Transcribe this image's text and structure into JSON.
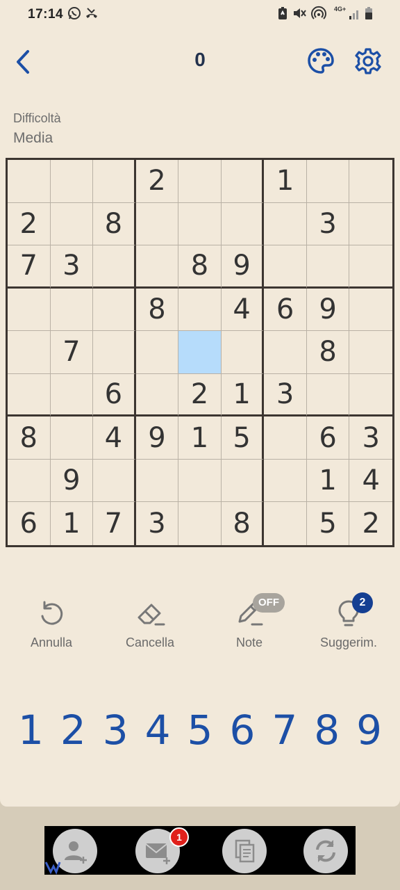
{
  "status_bar": {
    "time": "17:14",
    "network": "4G+",
    "icons": [
      "whatsapp-icon",
      "missed-call-icon",
      "battery-saver-icon",
      "mute-icon",
      "hotspot-icon",
      "signal-icon",
      "battery-icon"
    ]
  },
  "header": {
    "score": "0",
    "back_icon": "chevron-left-icon",
    "theme_icon": "palette-icon",
    "settings_icon": "gear-icon"
  },
  "difficulty": {
    "label": "Difficoltà",
    "value": "Media"
  },
  "grid": [
    [
      "",
      "",
      "",
      "2",
      "",
      "",
      "1",
      "",
      ""
    ],
    [
      "2",
      "",
      "8",
      "",
      "",
      "",
      "",
      "3",
      ""
    ],
    [
      "7",
      "3",
      "",
      "",
      "8",
      "9",
      "",
      "",
      ""
    ],
    [
      "",
      "",
      "",
      "8",
      "",
      "4",
      "6",
      "9",
      ""
    ],
    [
      "",
      "7",
      "",
      "",
      "",
      "",
      "",
      "8",
      ""
    ],
    [
      "",
      "",
      "6",
      "",
      "2",
      "1",
      "3",
      "",
      ""
    ],
    [
      "8",
      "",
      "4",
      "9",
      "1",
      "5",
      "",
      "6",
      "3"
    ],
    [
      "",
      "9",
      "",
      "",
      "",
      "",
      "",
      "1",
      "4"
    ],
    [
      "6",
      "1",
      "7",
      "3",
      "",
      "8",
      "",
      "5",
      "2"
    ]
  ],
  "selected_cell": {
    "row": 4,
    "col": 4
  },
  "tools": {
    "undo": "Annulla",
    "erase": "Cancella",
    "notes": "Note",
    "notes_state": "OFF",
    "hint": "Suggerim.",
    "hint_count": "2"
  },
  "numpad": [
    "1",
    "2",
    "3",
    "4",
    "5",
    "6",
    "7",
    "8",
    "9"
  ],
  "dock": {
    "mail_badge": "1",
    "icons": [
      "add-contact-icon",
      "mail-icon",
      "copy-icon",
      "refresh-icon"
    ]
  },
  "colors": {
    "background": "#f2e9da",
    "accent": "#1c4fa6",
    "selected": "#b6dcfb",
    "badge": "#153f92"
  }
}
